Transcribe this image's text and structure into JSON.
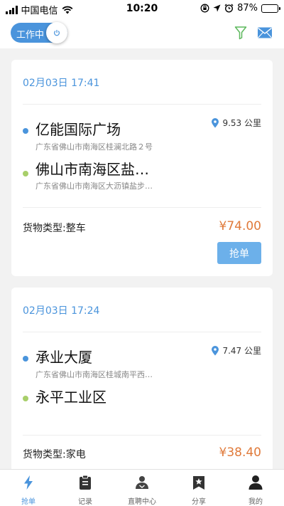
{
  "status_bar": {
    "carrier": "中国电信",
    "time": "10:20",
    "battery": "87%",
    "battery_level": 0.87
  },
  "header": {
    "toggle_label": "工作中",
    "icons": [
      "filter-icon",
      "mail-icon",
      "power-icon"
    ]
  },
  "colors": {
    "accent": "#4a94dc",
    "price": "#e07a3a",
    "destination_dot": "#a8cf6a",
    "button": "#6cb0ea"
  },
  "orders": [
    {
      "date": "02月03日 17:41",
      "from_name": "亿能国际广场",
      "from_addr": "广东省佛山市南海区桂澜北路２号",
      "distance": "9.53 公里",
      "to_name": "佛山市南海区盐…",
      "to_addr": "广东省佛山市南海区大沥镇盐步…",
      "cargo_label": "货物类型",
      "cargo_value": "整车",
      "price": "¥74.00",
      "button_label": "抢单"
    },
    {
      "date": "02月03日 17:24",
      "from_name": "承业大厦",
      "from_addr": "广东省佛山市南海区桂城南平西…",
      "distance": "7.47 公里",
      "to_name": "永平工业区",
      "to_addr": "",
      "cargo_label": "货物类型",
      "cargo_value": "家电",
      "price": "¥38.40"
    }
  ],
  "tabs": [
    {
      "label": "抢单",
      "icon": "lightning-icon",
      "active": true
    },
    {
      "label": "记录",
      "icon": "clipboard-icon"
    },
    {
      "label": "直聘中心",
      "icon": "recruit-icon"
    },
    {
      "label": "分享",
      "icon": "share-star-icon"
    },
    {
      "label": "我的",
      "icon": "profile-icon"
    }
  ]
}
